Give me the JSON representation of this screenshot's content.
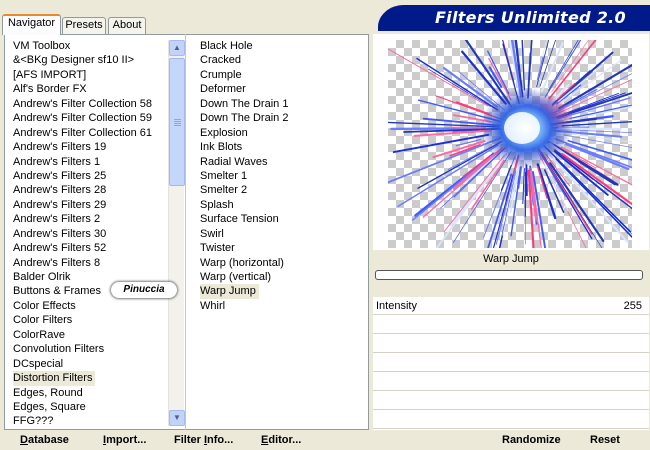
{
  "tabs": [
    {
      "label": "Navigator",
      "active": true
    },
    {
      "label": "Presets",
      "active": false
    },
    {
      "label": "About",
      "active": false
    }
  ],
  "title": "Filters Unlimited 2.0",
  "categories": [
    "VM Toolbox",
    "&<BKg Designer sf10 II>",
    "[AFS IMPORT]",
    "Alf's Border FX",
    "Andrew's Filter Collection 58",
    "Andrew's Filter Collection 59",
    "Andrew's Filter Collection 61",
    "Andrew's Filters 19",
    "Andrew's Filters 1",
    "Andrew's Filters 25",
    "Andrew's Filters 28",
    "Andrew's Filters 29",
    "Andrew's Filters 2",
    "Andrew's Filters 30",
    "Andrew's Filters 52",
    "Andrew's Filters 8",
    "Balder Olrik",
    "Buttons & Frames",
    "Color Effects",
    "Color Filters",
    "ColorRave",
    "Convolution Filters",
    "DCspecial",
    "Distortion Filters",
    "Edges, Round",
    "Edges, Square",
    "FFG???"
  ],
  "selected_category": "Distortion Filters",
  "filters": [
    "Black Hole",
    "Cracked",
    "Crumple",
    "Deformer",
    "Down The Drain 1",
    "Down The Drain 2",
    "Explosion",
    "Ink Blots",
    "Radial Waves",
    "Smelter 1",
    "Smelter 2",
    "Splash",
    "Surface Tension",
    "Swirl",
    "Twister",
    "Warp (horizontal)",
    "Warp (vertical)",
    "Warp Jump",
    "Whirl"
  ],
  "selected_filter": "Warp Jump",
  "watermark": "Pinuccia",
  "preview_filter_name": "Warp Jump",
  "parameters": [
    {
      "name": "Intensity",
      "value": "255"
    }
  ],
  "buttons": {
    "database": {
      "underlined": "D",
      "rest": "atabase"
    },
    "import": {
      "underlined": "I",
      "rest": "mport..."
    },
    "filter_info": {
      "before": "Filter ",
      "underlined": "I",
      "rest": "nfo..."
    },
    "editor": {
      "underlined": "E",
      "rest": "ditor..."
    },
    "randomize": "Randomize",
    "reset": "Reset"
  },
  "icons": {
    "scroll_up": "scroll-up-arrow-icon",
    "scroll_down": "scroll-down-arrow-icon"
  },
  "colors": {
    "banner": "#001a8a",
    "selection": "#ece9d8",
    "panel_bg": "#ece9d8"
  }
}
